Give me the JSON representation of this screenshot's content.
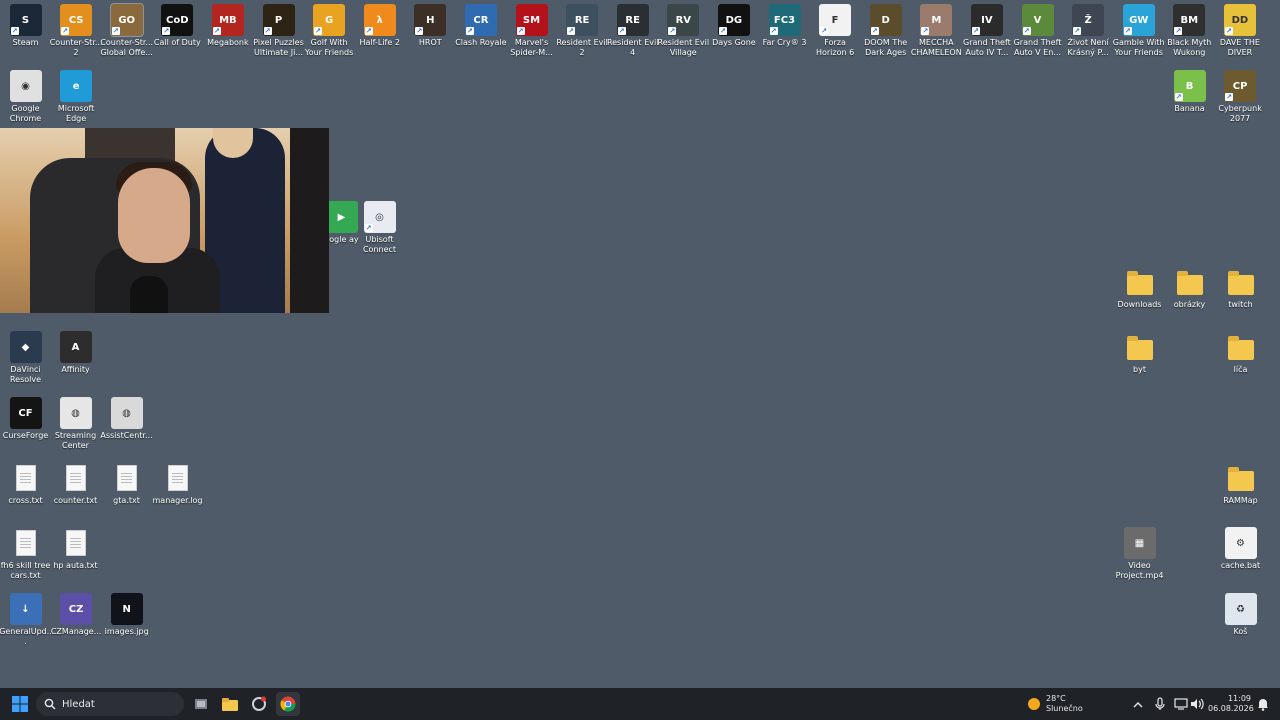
{
  "desktop": {
    "icons_top_row": [
      {
        "label": "Steam",
        "color": "#1b2838",
        "glyph": "S",
        "shortcut": true
      },
      {
        "label": "Counter-Str... 2",
        "color": "#e38f1d",
        "glyph": "CS",
        "shortcut": true
      },
      {
        "label": "Counter-Str... Global Offe...",
        "color": "#8a6a3c",
        "glyph": "GO",
        "shortcut": true,
        "selected": true
      },
      {
        "label": "Call of Duty",
        "color": "#111111",
        "glyph": "CoD",
        "shortcut": true
      },
      {
        "label": "Megabonk",
        "color": "#b2261f",
        "glyph": "MB",
        "shortcut": true
      },
      {
        "label": "Pixel Puzzles Ultimate Ji...",
        "color": "#2d2415",
        "glyph": "P",
        "shortcut": true
      },
      {
        "label": "Golf With Your Friends",
        "color": "#e8a320",
        "glyph": "G",
        "shortcut": true
      },
      {
        "label": "Half-Life 2",
        "color": "#f08a1c",
        "glyph": "λ",
        "shortcut": true
      },
      {
        "label": "HROT",
        "color": "#3b2f26",
        "glyph": "H",
        "shortcut": true
      },
      {
        "label": "Clash Royale",
        "color": "#2f6bb0",
        "glyph": "CR",
        "shortcut": true
      },
      {
        "label": "Marvel's Spider-M...",
        "color": "#b3121b",
        "glyph": "SM",
        "shortcut": true
      },
      {
        "label": "Resident Evil 2",
        "color": "#3d5060",
        "glyph": "RE",
        "shortcut": true
      },
      {
        "label": "Resident Evil 4",
        "color": "#2a2f33",
        "glyph": "RE",
        "shortcut": true
      },
      {
        "label": "Resident Evil Village",
        "color": "#3a4647",
        "glyph": "RV",
        "shortcut": true
      },
      {
        "label": "Days Gone",
        "color": "#111111",
        "glyph": "DG",
        "shortcut": true
      },
      {
        "label": "Far Cry® 3",
        "color": "#1e6a79",
        "glyph": "FC3",
        "shortcut": true
      },
      {
        "label": "Forza Horizon 6",
        "color": "#f2f2f2",
        "glyph": "F",
        "shortcut": true
      },
      {
        "label": "DOOM The Dark Ages",
        "color": "#5b4d2c",
        "glyph": "D",
        "shortcut": true
      },
      {
        "label": "MECCHA CHAMELEON",
        "color": "#9b7b6b",
        "glyph": "M",
        "shortcut": true
      },
      {
        "label": "Grand Theft Auto IV T...",
        "color": "#2b2b2b",
        "glyph": "IV",
        "shortcut": true
      },
      {
        "label": "Grand Theft Auto V En...",
        "color": "#5a8a3a",
        "glyph": "V",
        "shortcut": true
      },
      {
        "label": "Život Není Krásný P...",
        "color": "#3d4652",
        "glyph": "Ž",
        "shortcut": true
      },
      {
        "label": "Gamble With Your Friends",
        "color": "#2aa3d8",
        "glyph": "GW",
        "shortcut": true
      },
      {
        "label": "Black Myth Wukong",
        "color": "#2f2f2f",
        "glyph": "BM",
        "shortcut": true
      },
      {
        "label": "DAVE THE DIVER",
        "color": "#e8c13a",
        "glyph": "DD",
        "shortcut": true
      }
    ],
    "icons_second_row": [
      {
        "label": "Google Chrome",
        "color": "#e0e0e0",
        "glyph": "◉",
        "shortcut": false
      },
      {
        "label": "Microsoft Edge",
        "color": "#1f9bd8",
        "glyph": "e",
        "shortcut": false
      }
    ],
    "icons_second_row_right": [
      {
        "label": "Banana",
        "color": "#7bc04a",
        "glyph": "B",
        "shortcut": true
      },
      {
        "label": "Cyberpunk 2077",
        "color": "#6d5a2e",
        "glyph": "CP",
        "shortcut": true
      }
    ],
    "icons_mid": [
      {
        "label": "oogle ay",
        "color": "#34a853",
        "glyph": "▶",
        "shortcut": false
      },
      {
        "label": "Ubisoft Connect",
        "color": "#e8ecf2",
        "glyph": "◎",
        "shortcut": true
      }
    ],
    "folders_right": [
      {
        "label": "Downloads"
      },
      {
        "label": "obrázky"
      },
      {
        "label": "twitch"
      },
      {
        "label": "byt"
      },
      {
        "label": "líča"
      },
      {
        "label": "RAMMap"
      }
    ],
    "icons_left_col": [
      {
        "label": "DaVinci Resolve",
        "color": "#2b3b4f",
        "glyph": "◆",
        "shortcut": false
      },
      {
        "label": "Affinity",
        "color": "#2d2d2d",
        "glyph": "A",
        "shortcut": false
      },
      {
        "label": "CurseForge",
        "color": "#141414",
        "glyph": "CF",
        "shortcut": false
      },
      {
        "label": "Streaming Center",
        "color": "#e6e6e6",
        "glyph": "◍",
        "shortcut": false
      },
      {
        "label": "AssistCentr...",
        "color": "#d9d9d9",
        "glyph": "◍",
        "shortcut": false
      }
    ],
    "text_files": [
      {
        "label": "cross.txt"
      },
      {
        "label": "counter.txt"
      },
      {
        "label": "gta.txt"
      },
      {
        "label": "manager.log"
      },
      {
        "label": "fh6 skill tree cars.txt"
      },
      {
        "label": "hp auta.txt"
      }
    ],
    "misc_bottom": [
      {
        "label": "GeneralUpd...",
        "color": "#3b6fb8",
        "glyph": "↓"
      },
      {
        "label": "CZManage...",
        "color": "#5b4fa8",
        "glyph": "CZ"
      },
      {
        "label": "images.jpg",
        "color": "#10131a",
        "glyph": "N"
      }
    ],
    "right_bottom": [
      {
        "label": "Video Project.mp4",
        "color": "#6b6b6b",
        "glyph": "▦"
      },
      {
        "label": "cache.bat",
        "color": "#f2f2f2",
        "glyph": "⚙"
      },
      {
        "label": "Koš",
        "color": "#dfe6ee",
        "glyph": "♻"
      }
    ]
  },
  "webcam": {
    "icon": "webcam-overlay"
  },
  "taskbar": {
    "search_placeholder": "Hledat",
    "weather_temp": "28°C",
    "weather_desc": "Slunečno",
    "time": "11:09",
    "date": "06.08.2026",
    "colors": {
      "accent": "#0a84ff",
      "bg": "#1f2226"
    }
  }
}
